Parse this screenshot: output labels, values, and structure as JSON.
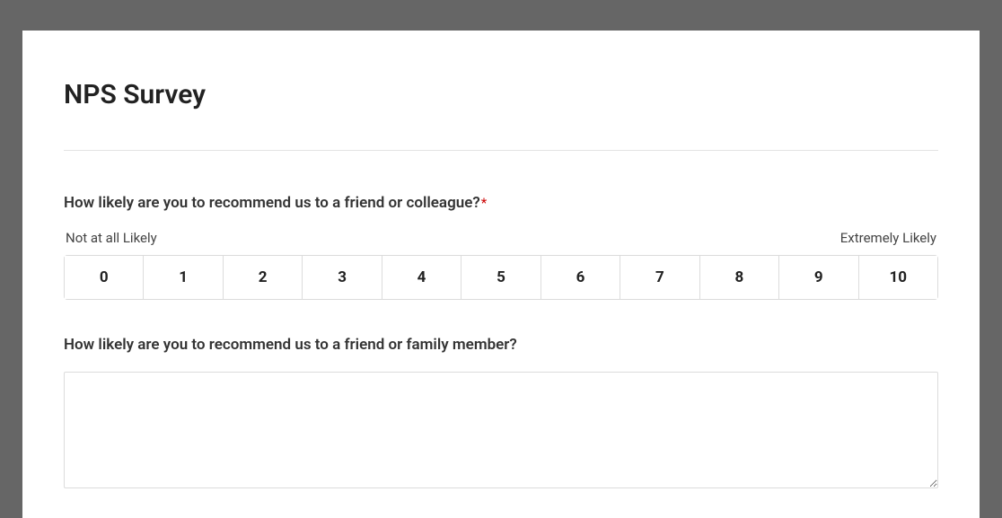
{
  "survey": {
    "title": "NPS Survey",
    "questions": {
      "q1": {
        "label": "How likely are you to recommend us to a friend or colleague?",
        "required_marker": "*",
        "scale_low_label": "Not at all Likely",
        "scale_high_label": "Extremely Likely",
        "options": [
          "0",
          "1",
          "2",
          "3",
          "4",
          "5",
          "6",
          "7",
          "8",
          "9",
          "10"
        ]
      },
      "q2": {
        "label": "How likely are you to recommend us to a friend or family member?",
        "value": ""
      }
    }
  }
}
